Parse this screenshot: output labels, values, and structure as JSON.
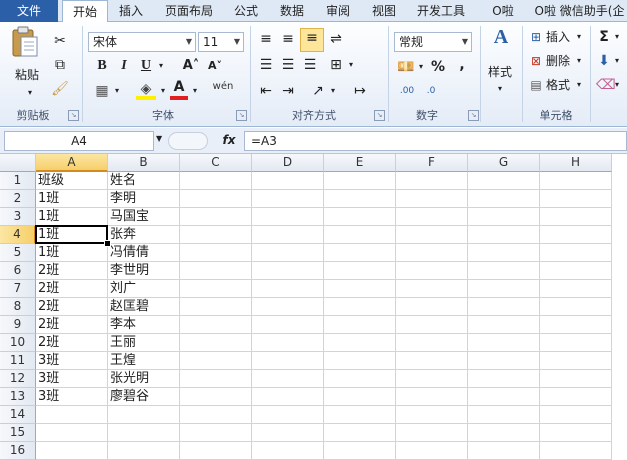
{
  "ribbon_tabs": [
    "文件",
    "开始",
    "插入",
    "页面布局",
    "公式",
    "数据",
    "审阅",
    "视图",
    "开发工具",
    "O啦",
    "O啦 微信助手(企"
  ],
  "active_tab": "开始",
  "clipboard": {
    "paste_label": "粘贴",
    "group_label": "剪贴板"
  },
  "font": {
    "name": "宋体",
    "size": "11",
    "bold": "B",
    "italic": "I",
    "underline": "U",
    "grow": "A˄",
    "shrink": "A˅",
    "phonetic": "wén",
    "group_label": "字体"
  },
  "alignment": {
    "group_label": "对齐方式"
  },
  "number": {
    "format": "常规",
    "percent": "%",
    "comma": ",",
    "group_label": "数字"
  },
  "styles": {
    "label": "样式"
  },
  "cells": {
    "insert_label": "插入",
    "delete_label": "删除",
    "format_label": "格式",
    "group_label": "单元格"
  },
  "editing": {
    "sum_label": "Σ"
  },
  "formula_bar": {
    "name_box": "A4",
    "fx_label": "fx",
    "formula": "=A3"
  },
  "columns": [
    "A",
    "B",
    "C",
    "D",
    "E",
    "F",
    "G",
    "H"
  ],
  "selected_column": "A",
  "selected_row": 4,
  "rows": [
    [
      "班级",
      "姓名"
    ],
    [
      "1班",
      "李明"
    ],
    [
      "1班",
      "马国宝"
    ],
    [
      "1班",
      "张奔"
    ],
    [
      "1班",
      "冯倩倩"
    ],
    [
      "2班",
      "李世明"
    ],
    [
      "2班",
      "刘广"
    ],
    [
      "2班",
      "赵匡碧"
    ],
    [
      "2班",
      "李本"
    ],
    [
      "2班",
      "王丽"
    ],
    [
      "3班",
      "王煌"
    ],
    [
      "3班",
      "张光明"
    ],
    [
      "3班",
      "廖碧谷"
    ],
    [
      "",
      ""
    ],
    [
      "",
      ""
    ],
    [
      "",
      ""
    ]
  ],
  "colors": {
    "accent": "#2b5fa8",
    "selection": "#f7cf6a",
    "grid": "#d4d4d4"
  }
}
